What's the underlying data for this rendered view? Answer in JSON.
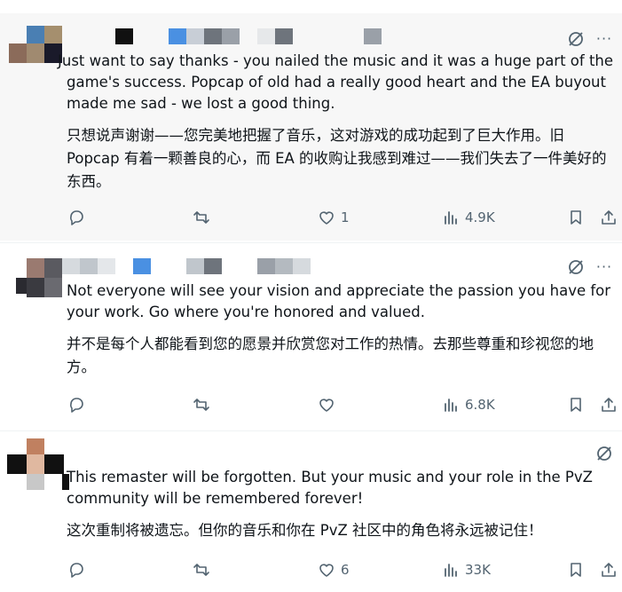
{
  "posts": [
    {
      "text": "Just want to say thanks - you nailed the music and it was a huge part of the game's success. Popcap of old had a really good heart and the EA buyout made me sad - we lost a good thing.",
      "translation": "只想说声谢谢——您完美地把握了音乐，这对游戏的成功起到了巨大作用。旧 Popcap 有着一颗善良的心，而 EA 的收购让我感到难过——我们失去了一件美好的东西。",
      "likes": "1",
      "views": "4.9K"
    },
    {
      "text": "Not everyone will see your vision and appreciate the passion you have for your work. Go where you're honored and valued.",
      "translation": "并不是每个人都能看到您的愿景并欣赏您对工作的热情。去那些尊重和珍视您的地方。",
      "likes": "",
      "views": "6.8K"
    },
    {
      "text": "This remaster will be forgotten. But your music and your role in the PvZ community will be remembered forever!",
      "translation": "这次重制将被遗忘。但你的音乐和你在 PvZ 社区中的角色将永远被记住！",
      "likes": "6",
      "views": "33K"
    }
  ],
  "icons": {
    "grok": "grok-icon",
    "more": "more-icon",
    "reply": "reply-icon",
    "repost": "repost-icon",
    "like": "heart-icon",
    "views": "views-icon",
    "bookmark": "bookmark-icon",
    "share": "share-icon"
  },
  "more_label": "···",
  "colors": {
    "text": "#0f1419",
    "muted": "#536471",
    "highlight_bg": "#f7f7f7"
  }
}
